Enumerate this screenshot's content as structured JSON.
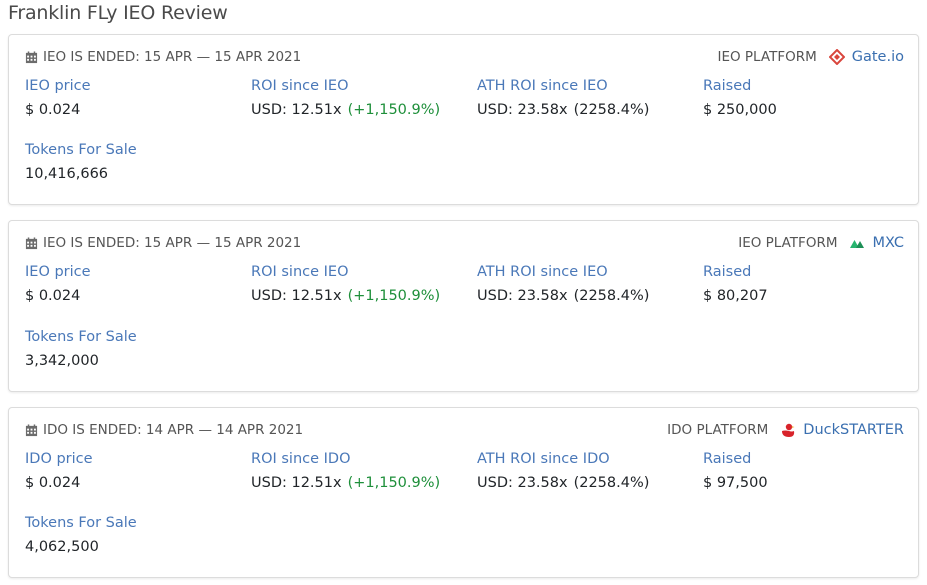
{
  "page": {
    "title": "Franklin FLy IEO Review"
  },
  "cards": [
    {
      "ended_text": "IEO IS ENDED: 15 APR — 15 APR 2021",
      "platform_label": "IEO PLATFORM",
      "platform_name": "Gate.io",
      "platform_icon": "gate-io-logo-icon",
      "price_label": "IEO price",
      "price_value": "$ 0.024",
      "roi_label": "ROI since IEO",
      "roi_usd": "USD: 12.51x",
      "roi_pct": "(+1,150.9%)",
      "ath_label": "ATH ROI since IEO",
      "ath_usd": "USD: 23.58x",
      "ath_pct": "(2258.4%)",
      "raised_label": "Raised",
      "raised_value": "$ 250,000",
      "tokens_label": "Tokens For Sale",
      "tokens_value": "10,416,666"
    },
    {
      "ended_text": "IEO IS ENDED: 15 APR — 15 APR 2021",
      "platform_label": "IEO PLATFORM",
      "platform_name": "MXC",
      "platform_icon": "mxc-logo-icon",
      "price_label": "IEO price",
      "price_value": "$ 0.024",
      "roi_label": "ROI since IEO",
      "roi_usd": "USD: 12.51x",
      "roi_pct": "(+1,150.9%)",
      "ath_label": "ATH ROI since IEO",
      "ath_usd": "USD: 23.58x",
      "ath_pct": "(2258.4%)",
      "raised_label": "Raised",
      "raised_value": "$ 80,207",
      "tokens_label": "Tokens For Sale",
      "tokens_value": "3,342,000"
    },
    {
      "ended_text": "IDO IS ENDED: 14 APR — 14 APR 2021",
      "platform_label": "IDO PLATFORM",
      "platform_name": "DuckSTARTER",
      "platform_icon": "duckstarter-logo-icon",
      "price_label": "IDO price",
      "price_value": "$ 0.024",
      "roi_label": "ROI since IDO",
      "roi_usd": "USD: 12.51x",
      "roi_pct": "(+1,150.9%)",
      "ath_label": "ATH ROI since IDO",
      "ath_usd": "USD: 23.58x",
      "ath_pct": "(2258.4%)",
      "raised_label": "Raised",
      "raised_value": "$ 97,500",
      "tokens_label": "Tokens For Sale",
      "tokens_value": "4,062,500"
    }
  ],
  "colors": {
    "label_blue": "#4a78b8",
    "link_blue": "#3a6fb0",
    "gain_green": "#1e8f3a",
    "gate_red": "#d9463d",
    "mxc_green": "#27b56f",
    "duck_red": "#d8232a"
  }
}
